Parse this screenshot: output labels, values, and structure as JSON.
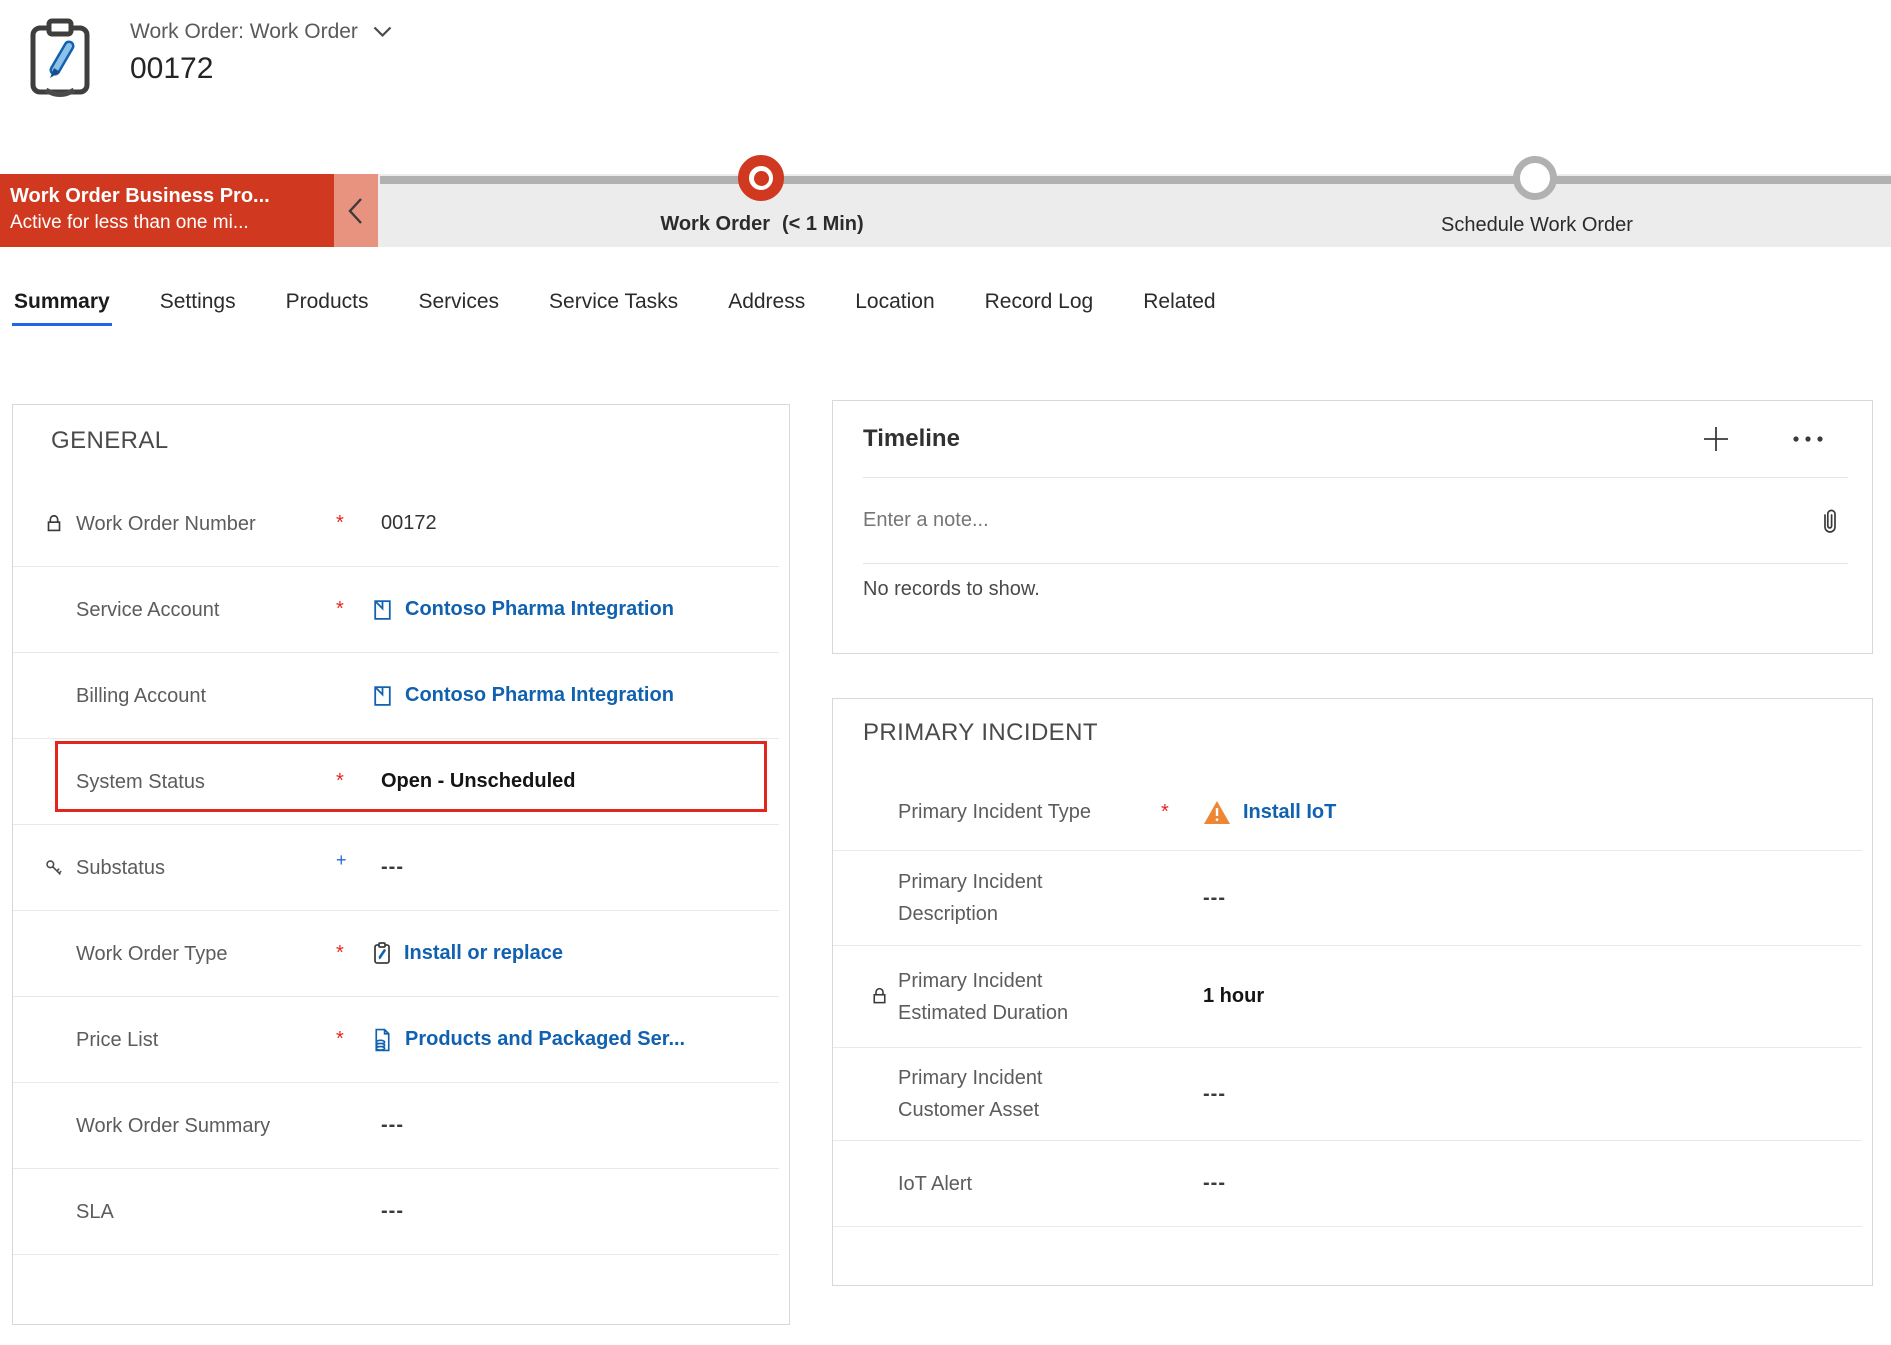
{
  "header": {
    "record_type": "Work Order: Work Order",
    "record_number": "00172"
  },
  "bpf": {
    "process_name": "Work Order Business Pro...",
    "process_status": "Active for less than one mi...",
    "stages": [
      {
        "label": "Work Order",
        "duration": "(< 1 Min)",
        "state": "active"
      },
      {
        "label": "Schedule Work Order",
        "duration": "",
        "state": "upcoming"
      }
    ]
  },
  "tabs": [
    {
      "label": "Summary",
      "active": true
    },
    {
      "label": "Settings"
    },
    {
      "label": "Products"
    },
    {
      "label": "Services"
    },
    {
      "label": "Service Tasks"
    },
    {
      "label": "Address"
    },
    {
      "label": "Location"
    },
    {
      "label": "Record Log"
    },
    {
      "label": "Related"
    }
  ],
  "general": {
    "title": "GENERAL",
    "fields": [
      {
        "label": "Work Order Number",
        "required": "*",
        "value": "00172",
        "locked": true
      },
      {
        "label": "Service Account",
        "required": "*",
        "value": "Contoso Pharma Integration",
        "link": true
      },
      {
        "label": "Billing Account",
        "required": "",
        "value": "Contoso Pharma Integration",
        "link": true
      },
      {
        "label": "System Status",
        "required": "*",
        "value": "Open - Unscheduled",
        "highlighted": true
      },
      {
        "label": "Substatus",
        "required": "+",
        "value": "---"
      },
      {
        "label": "Work Order Type",
        "required": "*",
        "value": "Install or replace",
        "link": true
      },
      {
        "label": "Price List",
        "required": "*",
        "value": "Products and Packaged Ser...",
        "link": true
      },
      {
        "label": "Work Order Summary",
        "required": "",
        "value": "---"
      },
      {
        "label": "SLA",
        "required": "",
        "value": "---"
      }
    ]
  },
  "timeline": {
    "title": "Timeline",
    "note_placeholder": "Enter a note...",
    "empty_message": "No records to show."
  },
  "primary_incident": {
    "title": "PRIMARY INCIDENT",
    "fields": [
      {
        "label": "Primary Incident Type",
        "required": "*",
        "value": "Install IoT",
        "link": true,
        "warning": true
      },
      {
        "label": "Primary Incident Description",
        "required": "",
        "value": "---"
      },
      {
        "label": "Primary Incident Estimated Duration",
        "required": "",
        "value": "1 hour",
        "locked": true
      },
      {
        "label": "Primary Incident Customer Asset",
        "required": "",
        "value": "---"
      },
      {
        "label": "IoT Alert",
        "required": "",
        "value": "---"
      }
    ]
  },
  "colors": {
    "bpf_red": "#d0391f",
    "bpf_salmon": "#e8937f",
    "link_blue": "#1061b0",
    "accent_blue": "#2266e3",
    "required_red": "#e8231d",
    "warning_orange": "#ed8733",
    "highlight_red": "#e3261d"
  }
}
